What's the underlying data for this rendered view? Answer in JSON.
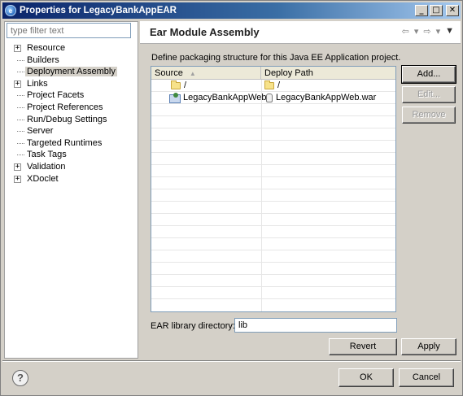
{
  "window": {
    "title": "Properties for LegacyBankAppEAR",
    "title_icon": "eclipse-icon",
    "controls": {
      "minimize": "_",
      "maximize": "□",
      "close": "✕"
    }
  },
  "filter": {
    "placeholder": "type filter text"
  },
  "tree": [
    {
      "label": "Resource",
      "expandable": true
    },
    {
      "label": "Builders",
      "expandable": false
    },
    {
      "label": "Deployment Assembly",
      "expandable": false,
      "selected": true
    },
    {
      "label": "Links",
      "expandable": true
    },
    {
      "label": "Project Facets",
      "expandable": false
    },
    {
      "label": "Project References",
      "expandable": false
    },
    {
      "label": "Run/Debug Settings",
      "expandable": false
    },
    {
      "label": "Server",
      "expandable": false
    },
    {
      "label": "Targeted Runtimes",
      "expandable": false
    },
    {
      "label": "Task Tags",
      "expandable": false
    },
    {
      "label": "Validation",
      "expandable": true
    },
    {
      "label": "XDoclet",
      "expandable": true
    }
  ],
  "page": {
    "title": "Ear Module Assembly",
    "description": "Define packaging structure for this Java EE Application project.",
    "nav": {
      "back": "⇦",
      "back_menu": "▾",
      "forward": "⇨",
      "forward_menu": "▾",
      "view_menu": "▼"
    }
  },
  "table": {
    "columns": [
      "Source",
      "Deploy Path"
    ],
    "sort_indicator": "▲",
    "rows": [
      {
        "source": "/",
        "source_icon": "folder-icon",
        "deploy": "/",
        "deploy_icon": "folder-icon"
      },
      {
        "source": "LegacyBankAppWeb",
        "source_icon": "web-project-icon",
        "deploy": "LegacyBankAppWeb.war",
        "deploy_icon": "war-file-icon"
      }
    ]
  },
  "buttons": {
    "add": "Add...",
    "edit": "Edit...",
    "remove": "Remove",
    "revert": "Revert",
    "apply": "Apply",
    "ok": "OK",
    "cancel": "Cancel"
  },
  "library": {
    "label": "EAR library directory:",
    "value": "lib"
  },
  "help": {
    "icon": "help-icon",
    "glyph": "?"
  }
}
